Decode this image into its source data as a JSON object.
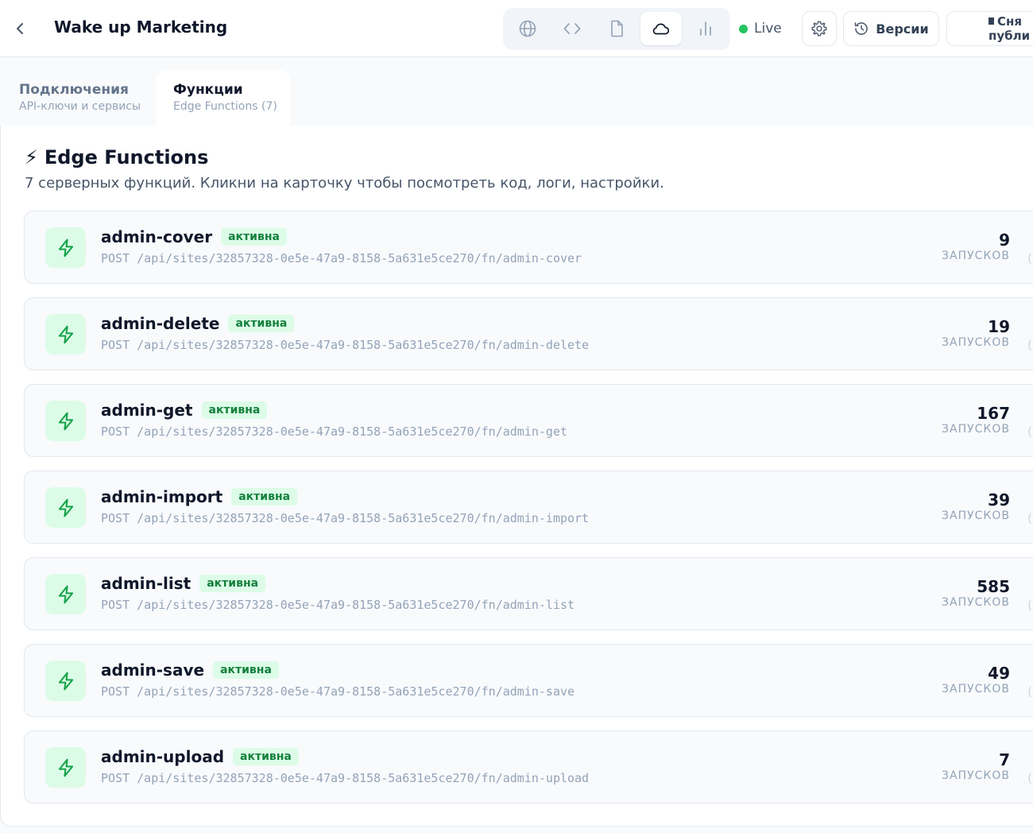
{
  "header": {
    "title": "Wake up Marketing",
    "live_label": "Live",
    "versions_label": "Версии",
    "unpublish_label": "Снять с публикации",
    "unpublish_line1": "Сня",
    "unpublish_line2": "публи"
  },
  "view_switcher": [
    {
      "icon": "globe-icon",
      "active": false
    },
    {
      "icon": "code-icon",
      "active": false
    },
    {
      "icon": "file-icon",
      "active": false
    },
    {
      "icon": "cloud-icon",
      "active": true
    },
    {
      "icon": "bar-chart-icon",
      "active": false
    }
  ],
  "tabs": [
    {
      "title": "Подключения",
      "subtitle": "API-ключи и сервисы",
      "active": false
    },
    {
      "title": "Функции",
      "subtitle": "Edge Functions (7)",
      "active": true
    }
  ],
  "section": {
    "title": "Edge Functions",
    "description": "7 серверных функций. Кликни на карточку чтобы посмотреть код, логи, настройки."
  },
  "functions": [
    {
      "name": "admin-cover",
      "status": "активна",
      "endpoint": "POST /api/sites/32857328-0e5e-47a9-8158-5a631e5ce270/fn/admin-cover",
      "runs": "9",
      "runs_label": "ЗАПУСКОВ"
    },
    {
      "name": "admin-delete",
      "status": "активна",
      "endpoint": "POST /api/sites/32857328-0e5e-47a9-8158-5a631e5ce270/fn/admin-delete",
      "runs": "19",
      "runs_label": "ЗАПУСКОВ"
    },
    {
      "name": "admin-get",
      "status": "активна",
      "endpoint": "POST /api/sites/32857328-0e5e-47a9-8158-5a631e5ce270/fn/admin-get",
      "runs": "167",
      "runs_label": "ЗАПУСКОВ"
    },
    {
      "name": "admin-import",
      "status": "активна",
      "endpoint": "POST /api/sites/32857328-0e5e-47a9-8158-5a631e5ce270/fn/admin-import",
      "runs": "39",
      "runs_label": "ЗАПУСКОВ"
    },
    {
      "name": "admin-list",
      "status": "активна",
      "endpoint": "POST /api/sites/32857328-0e5e-47a9-8158-5a631e5ce270/fn/admin-list",
      "runs": "585",
      "runs_label": "ЗАПУСКОВ"
    },
    {
      "name": "admin-save",
      "status": "активна",
      "endpoint": "POST /api/sites/32857328-0e5e-47a9-8158-5a631e5ce270/fn/admin-save",
      "runs": "49",
      "runs_label": "ЗАПУСКОВ"
    },
    {
      "name": "admin-upload",
      "status": "активна",
      "endpoint": "POST /api/sites/32857328-0e5e-47a9-8158-5a631e5ce270/fn/admin-upload",
      "runs": "7",
      "runs_label": "ЗАПУСКОВ"
    }
  ],
  "colors": {
    "accent_green": "#22c55e",
    "badge_text": "#15803d",
    "badge_bg": "#dcfce7",
    "text_primary": "#0f172a",
    "text_muted": "#94a3b8"
  }
}
